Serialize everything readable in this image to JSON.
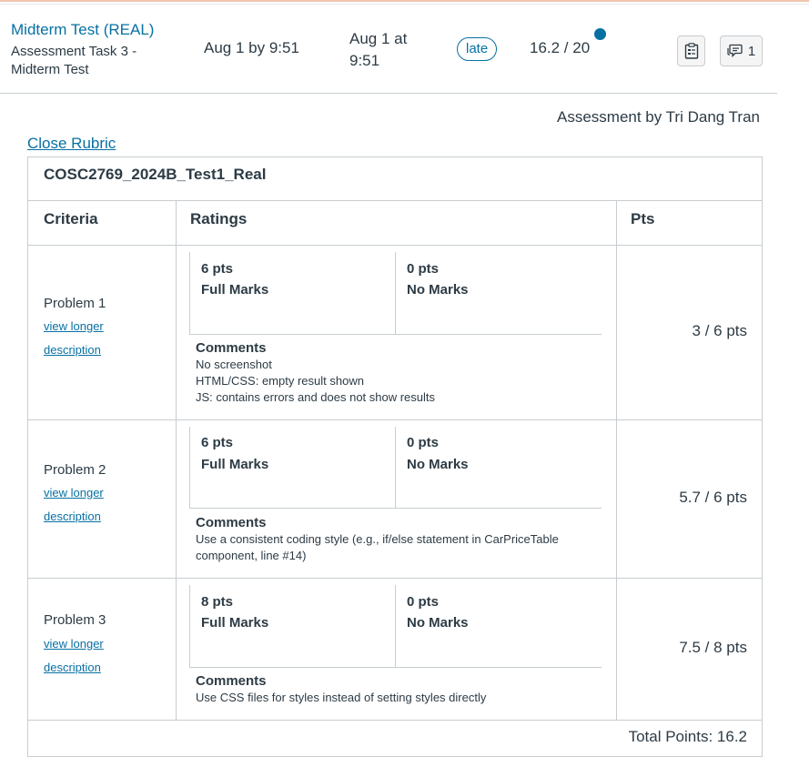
{
  "assignment": {
    "title": "Midterm Test (REAL)",
    "subtitle_line1": "Assessment Task 3 -",
    "subtitle_line2": "Midterm Test",
    "due": "Aug 1 by 9:51",
    "submitted_line1": "Aug 1 at",
    "submitted_line2": "9:51",
    "status_badge": "late",
    "score": "16.2 / 20",
    "comment_count": "1",
    "icons": {
      "rubric": "rubric-icon",
      "comments": "comment-bubble-icon",
      "unread": "unread-dot"
    },
    "colors": {
      "link": "#0770a3",
      "border": "#c7cdd1",
      "text": "#2d3b45"
    }
  },
  "assessor": "Assessment by Tri Dang Tran",
  "close_rubric": "Close Rubric",
  "rubric": {
    "title": "COSC2769_2024B_Test1_Real",
    "headers": {
      "criteria": "Criteria",
      "ratings": "Ratings",
      "pts": "Pts"
    },
    "view_longer_line1": "view longer",
    "view_longer_line2": "description",
    "comments_label": "Comments",
    "criteria": [
      {
        "name": "Problem 1",
        "ratings": [
          {
            "pts": "6 pts",
            "desc": "Full Marks"
          },
          {
            "pts": "0 pts",
            "desc": "No Marks"
          }
        ],
        "comments": [
          "No screenshot",
          "HTML/CSS: empty result shown",
          "JS: contains errors and does not show results"
        ],
        "points": "3 / 6 pts"
      },
      {
        "name": "Problem 2",
        "ratings": [
          {
            "pts": "6 pts",
            "desc": "Full Marks"
          },
          {
            "pts": "0 pts",
            "desc": "No Marks"
          }
        ],
        "comments": [
          "Use a consistent coding style (e.g., if/else statement in CarPriceTable",
          "component, line #14)"
        ],
        "points": "5.7 / 6 pts"
      },
      {
        "name": "Problem 3",
        "ratings": [
          {
            "pts": "8 pts",
            "desc": "Full Marks"
          },
          {
            "pts": "0 pts",
            "desc": "No Marks"
          }
        ],
        "comments": [
          "Use CSS files for styles instead of setting styles directly"
        ],
        "points": "7.5 / 8 pts"
      }
    ],
    "total": "Total Points: 16.2"
  }
}
